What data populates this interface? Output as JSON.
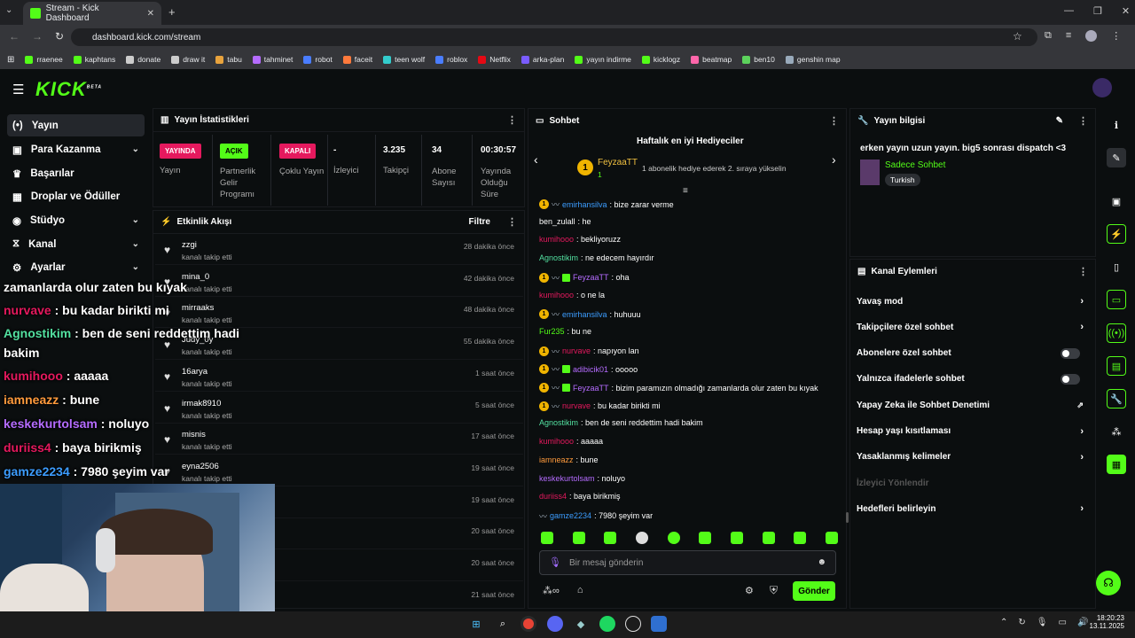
{
  "browser": {
    "tab_title": "Stream - Kick Dashboard",
    "url": "dashboard.kick.com/stream",
    "bookmarks": [
      "rraenee",
      "kaphtans",
      "donate",
      "draw it",
      "tabu",
      "tahminet",
      "robot",
      "faceit",
      "teen wolf",
      "roblox",
      "Netflix",
      "arka-plan",
      "yayın indirme",
      "kicklogz",
      "beatmap",
      "ben10",
      "genshin map"
    ]
  },
  "app": {
    "logo": "KICK",
    "logo_sup": "BETA"
  },
  "sidebar": {
    "items": [
      {
        "icon": "live-icon",
        "label": "Yayın"
      },
      {
        "icon": "money-icon",
        "label": "Para Kazanma"
      },
      {
        "icon": "trophy-icon",
        "label": "Başarılar"
      },
      {
        "icon": "gift-icon",
        "label": "Droplar ve Ödüller"
      },
      {
        "icon": "studio-icon",
        "label": "Stüdyo"
      },
      {
        "icon": "channel-icon",
        "label": "Kanal"
      },
      {
        "icon": "settings-icon",
        "label": "Ayarlar"
      }
    ]
  },
  "stats": {
    "title": "Yayın İstatistikleri",
    "items": [
      {
        "badge": "YAYINDA",
        "label": "Yayın",
        "color": "#e5195e"
      },
      {
        "badge": "AÇIK",
        "label": "Partnerlik Gelir Programı",
        "color": "#53fc18"
      },
      {
        "badge": "KAPALI",
        "label": "Çoklu Yayın",
        "color": "#e5195e"
      },
      {
        "value": "-",
        "label": "İzleyici"
      },
      {
        "value": "3.235",
        "label": "Takipçi"
      },
      {
        "value": "34",
        "label": "Abone Sayısı"
      },
      {
        "value": "00:30:57",
        "label": "Yayında Olduğu Süre"
      }
    ]
  },
  "activity": {
    "title": "Etkinlik Akışı",
    "filter": "Filtre",
    "items": [
      {
        "name": "zzgi",
        "sub": "kanalı takip etti",
        "time": "28 dakika önce"
      },
      {
        "name": "mina_0",
        "sub": "kanalı takip etti",
        "time": "42 dakika önce"
      },
      {
        "name": "mirraaks",
        "sub": "kanalı takip etti",
        "time": "48 dakika önce"
      },
      {
        "name": "Judy_0y",
        "sub": "kanalı takip etti",
        "time": "55 dakika önce"
      },
      {
        "name": "16arya",
        "sub": "kanalı takip etti",
        "time": "1 saat önce"
      },
      {
        "name": "irmak8910",
        "sub": "kanalı takip etti",
        "time": "5 saat önce"
      },
      {
        "name": "misnis",
        "sub": "kanalı takip etti",
        "time": "17 saat önce"
      },
      {
        "name": "eyna2506",
        "sub": "kanalı takip etti",
        "time": "19 saat önce"
      },
      {
        "name": "",
        "sub": "",
        "time": "19 saat önce"
      },
      {
        "name": "",
        "sub": "",
        "time": "20 saat önce"
      },
      {
        "name": "",
        "sub": "",
        "time": "20 saat önce"
      },
      {
        "name": "",
        "sub": "",
        "time": "21 saat önce"
      }
    ]
  },
  "overlay": [
    {
      "user": "zamanlarda olur zaten bu kıyak",
      "user_color": "#ffffff",
      "text": ""
    },
    {
      "user": "nurvave",
      "user_color": "#e5195e",
      "text": " : bu kadar birikti mi"
    },
    {
      "user": "Agnostikim",
      "user_color": "#53e0a0",
      "text": " : ben de seni reddettim hadi"
    },
    {
      "user": "bakim",
      "user_color": "#ffffff",
      "text": ""
    },
    {
      "user": "kumihooo",
      "user_color": "#e5195e",
      "text": " : aaaaa"
    },
    {
      "user": "iamneazz",
      "user_color": "#ff9a3c",
      "text": " : bune"
    },
    {
      "user": "keskekurtolsam",
      "user_color": "#b56cff",
      "text": " : noluyo"
    },
    {
      "user": "duriiss4",
      "user_color": "#e5195e",
      "text": " : baya birikmiş"
    },
    {
      "user": "gamze2234",
      "user_color": "#3c9dff",
      "text": " : 7980 şeyim var"
    }
  ],
  "chat": {
    "title": "Sohbet",
    "gifters_title": "Haftalık en iyi Hediyeciler",
    "top_gifter": "FeyzaaTT",
    "top_gifter_count": "1",
    "gifter_note": "1 abonelik hediye ederek 2. sıraya yükselin",
    "messages": [
      {
        "user": "emirhansilva",
        "color": "#3c9dff",
        "text": ": bize zarar verme"
      },
      {
        "user": "ben_zulall",
        "color": "#ffffff",
        "text": ": he"
      },
      {
        "user": "kumihooo",
        "color": "#e5195e",
        "text": ": bekliyoruzz"
      },
      {
        "user": "Agnostikim",
        "color": "#53e0a0",
        "text": ": ne edecem hayırdır"
      },
      {
        "user": "FeyzaaTT",
        "color": "#b56cff",
        "text": ": oha"
      },
      {
        "user": "kumihooo",
        "color": "#e5195e",
        "text": ": o ne la"
      },
      {
        "user": "emirhansilva",
        "color": "#3c9dff",
        "text": ": huhuuu"
      },
      {
        "user": "Fur235",
        "color": "#53fc18",
        "text": ": bu ne"
      },
      {
        "user": "nurvave",
        "color": "#e5195e",
        "text": ": napıyon lan"
      },
      {
        "user": "adibicik01",
        "color": "#b56cff",
        "text": ": ooooo"
      },
      {
        "user": "FeyzaaTT",
        "color": "#b56cff",
        "text": ": bizim paramızın olmadığı zamanlarda olur zaten bu kıyak"
      },
      {
        "user": "nurvave",
        "color": "#e5195e",
        "text": ": bu kadar birikti mi"
      },
      {
        "user": "Agnostikim",
        "color": "#53e0a0",
        "text": ": ben de seni reddettim hadi bakim"
      },
      {
        "user": "kumihooo",
        "color": "#e5195e",
        "text": ": aaaaa"
      },
      {
        "user": "iamneazz",
        "color": "#ff9a3c",
        "text": ": bune"
      },
      {
        "user": "keskekurtolsam",
        "color": "#b56cff",
        "text": ": noluyo"
      },
      {
        "user": "duriiss4",
        "color": "#e5195e",
        "text": ": baya birikmiş"
      },
      {
        "user": "gamze2234",
        "color": "#3c9dff",
        "text": ": 7980 şeyim var"
      }
    ],
    "input_placeholder": "Bir mesaj gönderin",
    "send_label": "Gönder"
  },
  "stream_info": {
    "title": "Yayın bilgisi",
    "stream_title": "erken yayın uzun yayın. big5 sonrası dispatch <3",
    "category": "Sadece Sohbet",
    "language": "Turkish"
  },
  "channel_actions": {
    "title": "Kanal Eylemleri",
    "items": [
      {
        "label": "Yavaş mod",
        "control": "arrow"
      },
      {
        "label": "Takipçilere özel sohbet",
        "control": "arrow"
      },
      {
        "label": "Abonelere özel sohbet",
        "control": "toggle"
      },
      {
        "label": "Yalnızca ifadelerle sohbet",
        "control": "toggle"
      },
      {
        "label": "Yapay Zeka ile Sohbet Denetimi",
        "control": "external"
      },
      {
        "label": "Hesap yaşı kısıtlaması",
        "control": "arrow"
      },
      {
        "label": "Yasaklanmış kelimeler",
        "control": "arrow"
      },
      {
        "label": "İzleyici Yönlendir",
        "control": "disabled"
      },
      {
        "label": "Hedefleri belirleyin",
        "control": "arrow"
      }
    ]
  },
  "taskbar": {
    "time": "18:20:23",
    "date": "13.11.2025"
  }
}
